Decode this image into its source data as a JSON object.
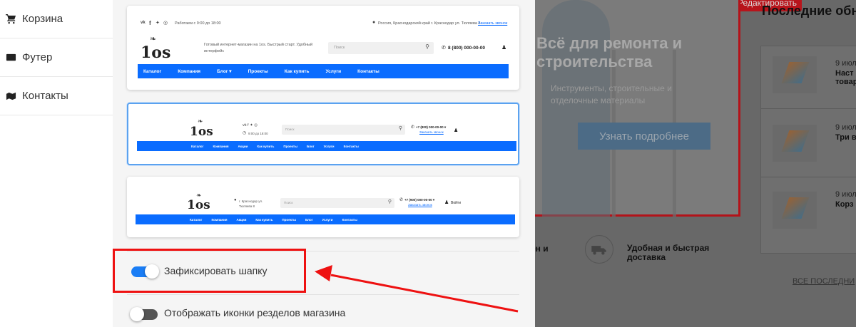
{
  "sidebar": {
    "items": [
      {
        "icon": "cart-icon",
        "label": "Корзина"
      },
      {
        "icon": "footer-icon",
        "label": "Футер"
      },
      {
        "icon": "map-icon",
        "label": "Контакты"
      }
    ]
  },
  "header_option_1": {
    "topbar_hours": "Работаем с 9:00 до 18:00",
    "topbar_address": "Россия, Краснодарский край г. Краснодар ул. Тюляева 8",
    "topbar_callback": "Заказать звонок",
    "logo": "1os",
    "tagline": "Готовый интернет-магазин на 1os. Быстрый старт. Удобный интерфейс",
    "search_placeholder": "Поиск",
    "phone": "8 (800) 000-00-00",
    "nav": [
      "Каталог",
      "Компания",
      "Блог ▾",
      "Проекты",
      "Как купить",
      "Услуги",
      "Контакты"
    ]
  },
  "header_option_2": {
    "logo": "1os",
    "hours": "9:00 до 18:00",
    "search_placeholder": "Поиск",
    "phone": "+7 (800) 000-00-00 ▾",
    "callback": "Заказать звонок",
    "nav": [
      "Каталог",
      "Компания",
      "Акции",
      "Как купить",
      "Проекты",
      "Блог",
      "Услуги",
      "Контакты"
    ]
  },
  "header_option_3": {
    "logo": "1os",
    "address": "г. Краснодар ул. Тюляева 8",
    "search_placeholder": "Поиск",
    "phone": "+7 (900) 000-00-00 ▾",
    "callback": "Заказать звонок",
    "login": "Войти",
    "nav": [
      "Каталог",
      "Компания",
      "Акции",
      "Как купить",
      "Проекты",
      "Блог",
      "Услуги",
      "Контакты"
    ]
  },
  "toggles": [
    {
      "label": "Зафиксировать шапку",
      "on": true
    },
    {
      "label": "Отображать иконки резделов магазина",
      "on": false
    }
  ],
  "background": {
    "edit_button": "Редактировать",
    "banner_title": "Всё для ремонта и строительства",
    "banner_subtitle": "Инструменты, строительные и отделочные материалы",
    "banner_button": "Узнать подробнее",
    "feature_1": "ен и",
    "feature_2": "Удобная и быстрая доставка",
    "news_title": "Последние обн",
    "news": [
      {
        "date": "9 июл",
        "title": "Наст товар"
      },
      {
        "date": "9 июл",
        "title": "Три в"
      },
      {
        "date": "9 июл",
        "title": "Корз"
      }
    ],
    "all_link": "ВСЕ ПОСЛЕДНИ"
  },
  "colors": {
    "accent": "#0a6cff",
    "highlight": "#ee1111",
    "toggle_on": "#1a7df5"
  }
}
